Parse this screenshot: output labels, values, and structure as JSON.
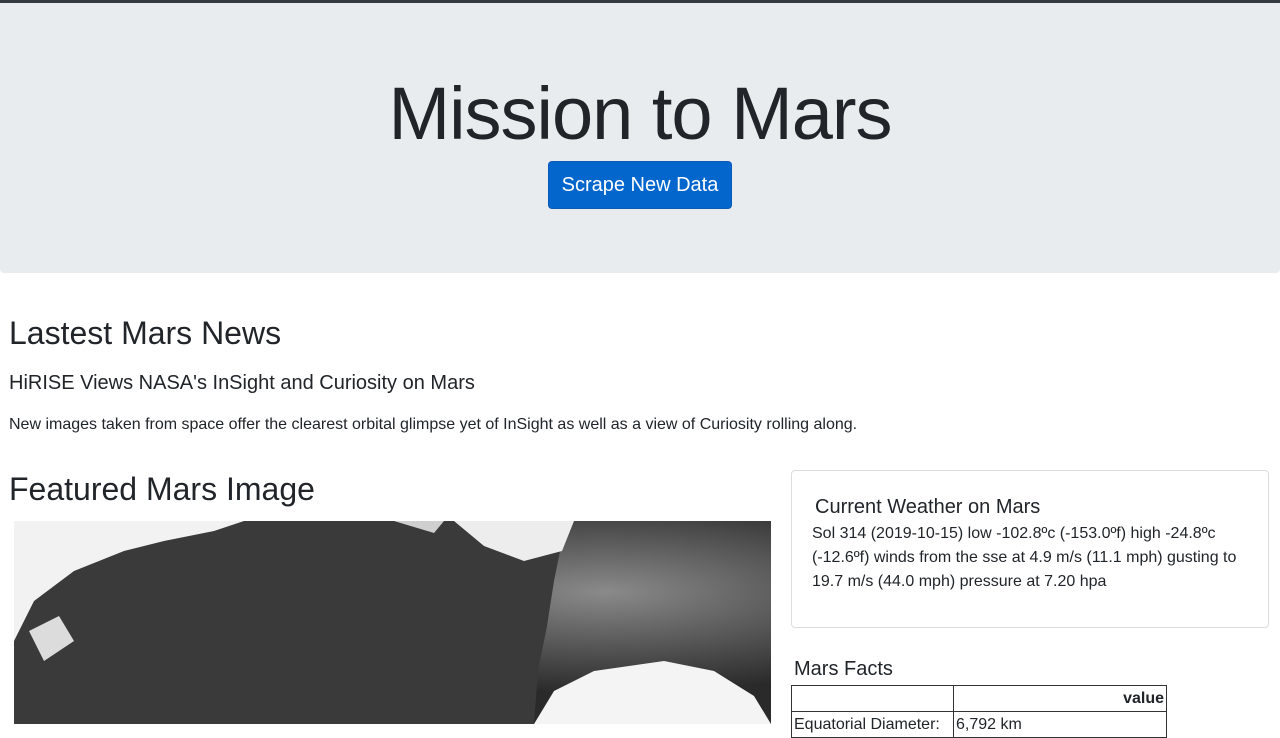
{
  "header": {
    "title": "Mission to Mars",
    "button_label": "Scrape New Data",
    "accent_color": "#0366cc",
    "background_color": "#e9ecef"
  },
  "news": {
    "heading": "Lastest Mars News",
    "title": "HiRISE Views NASA's InSight and Curiosity on Mars",
    "paragraph": "New images taken from space offer the clearest orbital glimpse yet of InSight as well as a view of Curiosity rolling along."
  },
  "featured": {
    "heading": "Featured Mars Image",
    "image_icon": "mars-surface-image"
  },
  "weather": {
    "heading": "Current Weather on Mars",
    "text": "Sol 314 (2019-10-15) low -102.8ºc (-153.0ºf) high -24.8ºc (-12.6ºf) winds from the sse at 4.9 m/s (11.1 mph) gusting to 19.7 m/s (44.0 mph) pressure at 7.20 hpa"
  },
  "facts": {
    "heading": "Mars Facts",
    "columns": [
      "",
      "value"
    ],
    "rows": [
      [
        "Equatorial Diameter:",
        "6,792 km"
      ]
    ]
  }
}
